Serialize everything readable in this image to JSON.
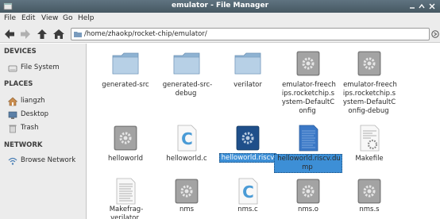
{
  "window": {
    "title": "emulator - File Manager"
  },
  "menubar": [
    "File",
    "Edit",
    "View",
    "Go",
    "Help"
  ],
  "location": {
    "path": "/home/zhaokp/rocket-chip/emulator/"
  },
  "sidebar": {
    "devices_header": "DEVICES",
    "devices": [
      {
        "label": "File System",
        "icon": "drive-icon"
      }
    ],
    "places_header": "PLACES",
    "places": [
      {
        "label": "liangzh",
        "icon": "home-icon"
      },
      {
        "label": "Desktop",
        "icon": "desktop-icon"
      },
      {
        "label": "Trash",
        "icon": "trash-icon"
      }
    ],
    "network_header": "NETWORK",
    "network": [
      {
        "label": "Browse Network",
        "icon": "network-icon"
      }
    ]
  },
  "files": [
    {
      "name": "generated-src",
      "type": "folder"
    },
    {
      "name": "generated-src-debug",
      "type": "folder"
    },
    {
      "name": "verilator",
      "type": "folder"
    },
    {
      "name": "emulator-freechips.rocketchip.system-DefaultConfig",
      "type": "executable"
    },
    {
      "name": "emulator-freechips.rocketchip.system-DefaultConfig-debug",
      "type": "executable"
    },
    {
      "name": "helloworld",
      "type": "executable"
    },
    {
      "name": "helloworld.c",
      "type": "c-source"
    },
    {
      "name": "helloworld.riscv",
      "type": "executable",
      "selected": true
    },
    {
      "name": "helloworld.riscv.dump",
      "type": "text",
      "selected": true
    },
    {
      "name": "Makefile",
      "type": "makefile"
    },
    {
      "name": "Makefrag-verilator",
      "type": "text"
    },
    {
      "name": "nms",
      "type": "executable"
    },
    {
      "name": "nms.c",
      "type": "c-source"
    },
    {
      "name": "nms.o",
      "type": "executable"
    },
    {
      "name": "nms.s",
      "type": "executable"
    }
  ],
  "colors": {
    "selection": "#3d8fd6",
    "titlebar": "#55676f",
    "folder": "#a9c6e0"
  }
}
